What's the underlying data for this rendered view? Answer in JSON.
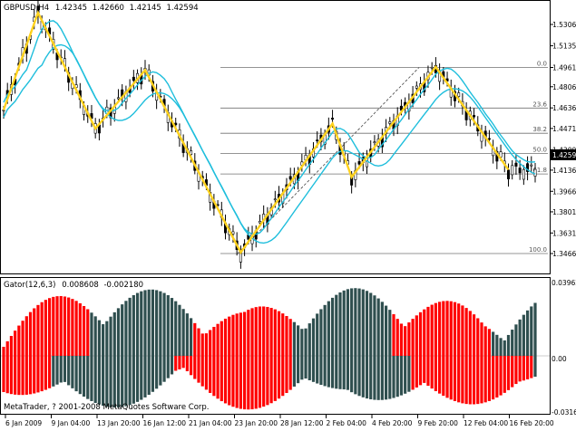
{
  "main_chart": {
    "symbol_label": "GBPUSD,H4",
    "open": "1.42345",
    "high": "1.42660",
    "low": "1.42145",
    "close": "1.42594",
    "price_ticks": [
      "1.53065",
      "1.51350",
      "1.49610",
      "1.48060",
      "1.46360",
      "1.44710",
      "1.43000",
      "1.41360",
      "1.39660",
      "1.38010",
      "1.36310",
      "1.34660"
    ],
    "current_price_badge": "1.42594",
    "colors": {
      "bull_candle": "#000000",
      "bear_candle": "#000000",
      "envelope": "#1ebedc",
      "zigzag": "#ffd21e",
      "fib_line": "#707070",
      "badge_bg": "#000000",
      "badge_text": "#ffffff"
    },
    "fibonacci_levels": [
      {
        "label": "0.0",
        "price": 1.4961
      },
      {
        "label": "23.6",
        "price": 1.4635
      },
      {
        "label": "38.2",
        "price": 1.4432
      },
      {
        "label": "50.0",
        "price": 1.4269
      },
      {
        "label": "61.8",
        "price": 1.4105
      },
      {
        "label": "100.0",
        "price": 1.3466
      }
    ],
    "zigzag_pivots": [
      {
        "time": "6 Jan 2009 00:00",
        "price": 1.462
      },
      {
        "time": "8 Jan 2009 12:00",
        "price": 1.54
      },
      {
        "time": "12 Jan 2009 04:00",
        "price": 1.447
      },
      {
        "time": "15 Jan 2009 12:00",
        "price": 1.494
      },
      {
        "time": "22 Jan 2009 20:00",
        "price": 1.3475
      },
      {
        "time": "29 Jan 2009 00:00",
        "price": 1.451
      },
      {
        "time": "30 Jan 2009 08:00",
        "price": 1.408
      },
      {
        "time": "6 Feb 2009 08:00",
        "price": 1.4965
      },
      {
        "time": "12 Feb 2009 16:00",
        "price": 1.414
      }
    ]
  },
  "indicator": {
    "title": "Gator(12,6,3)",
    "value_1": "0.008608",
    "value_2": "-0.002180",
    "ticks": [
      "0.039629",
      "0.00",
      "-0.03161"
    ],
    "colors": {
      "increase": "#ff0000",
      "decrease": "#2f4f4f"
    }
  },
  "watermark": "MetaTrader, ? 2001-2008 MetaQuotes Software Corp.",
  "time_axis": [
    "6 Jan 2009",
    "9 Jan 04:00",
    "13 Jan 20:00",
    "16 Jan 12:00",
    "21 Jan 04:00",
    "23 Jan 20:00",
    "28 Jan 12:00",
    "2 Feb 04:00",
    "4 Feb 20:00",
    "9 Feb 20:00",
    "12 Feb 04:00",
    "16 Feb 20:00"
  ]
}
